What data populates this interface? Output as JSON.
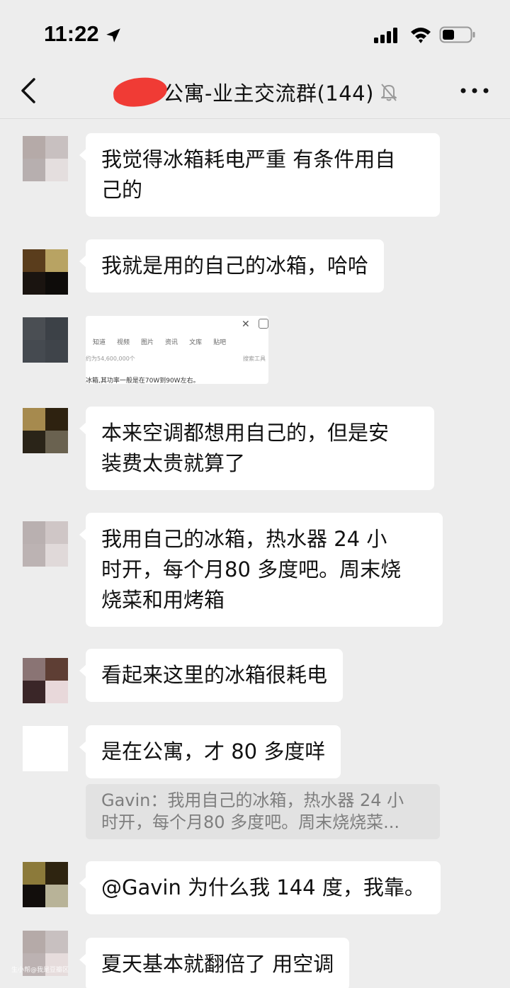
{
  "status_bar": {
    "time": "11:22"
  },
  "nav": {
    "title": "公寓-业主交流群(144)"
  },
  "messages": [
    {
      "text_lines": [
        "我觉得冰箱耗电严重 有条件用自",
        "己的"
      ]
    },
    {
      "text_lines": [
        "我就是用的自己的冰箱，哈哈"
      ]
    },
    {
      "image": {
        "tabs": [
          "知道",
          "视频",
          "图片",
          "资讯",
          "文库",
          "贴吧"
        ],
        "result_count": "约为54,600,000个",
        "tools": "搜索工具",
        "snippet": "冰箱,其功率一般是在70W到90W左右。"
      }
    },
    {
      "text_lines": [
        "本来空调都想用自己的，但是安",
        "装费太贵就算了"
      ]
    },
    {
      "text_lines": [
        "我用自己的冰箱，热水器 24 小",
        "时开，每个月80 多度吧。周末烧",
        "烧菜和用烤箱"
      ]
    },
    {
      "text_lines": [
        "看起来这里的冰箱很耗电"
      ]
    },
    {
      "text_lines": [
        "是在公寓，才 80 多度咩"
      ],
      "quote_lines": [
        "Gavin：我用自己的冰箱，热水器 24 小",
        "时开，每个月80 多度吧。周末烧烧菜..."
      ]
    },
    {
      "text_lines": [
        "@Gavin 为什么我 144 度，我靠。"
      ]
    },
    {
      "text_lines": [
        "夏天基本就翻倍了  用空调"
      ]
    }
  ],
  "watermark": "生小帮@我是豆瓣区",
  "colors": {
    "background": "#ededed",
    "bubble": "#ffffff",
    "redaction": "#f03b35"
  }
}
